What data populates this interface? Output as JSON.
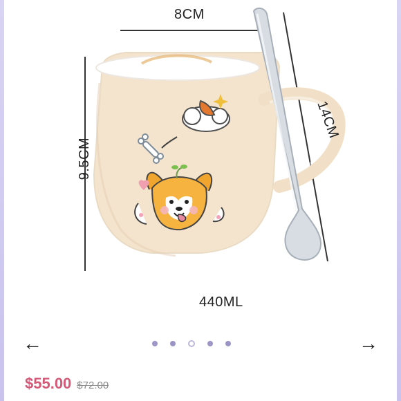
{
  "image": {
    "dimensions": {
      "width": "8CM",
      "height": "9.5CM",
      "spoon": "14CM"
    },
    "capacity": "440ML"
  },
  "carousel": {
    "prev_label": "←",
    "next_label": "→",
    "dots": [
      1,
      2,
      3,
      4,
      5
    ]
  },
  "pricing": {
    "price": "$55.00",
    "old_price": "$72.00"
  },
  "icons": {
    "prev": "arrow-left-icon",
    "next": "arrow-right-icon"
  }
}
